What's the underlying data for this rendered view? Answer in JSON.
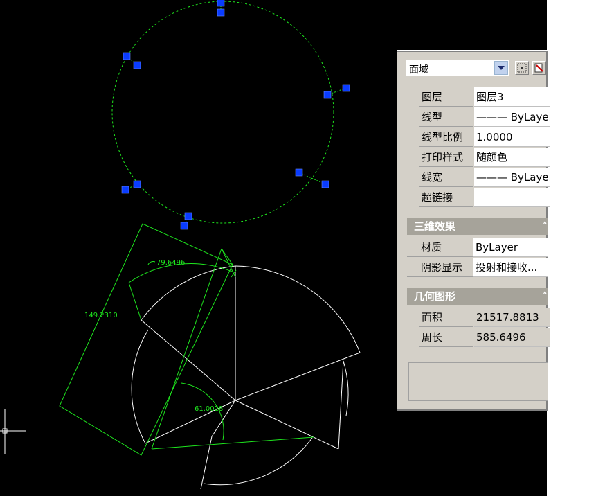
{
  "palette": {
    "object_type": "面域",
    "general": [
      {
        "key": "图层",
        "value": "图层3"
      },
      {
        "key": "线型",
        "value": "——— ByLayer"
      },
      {
        "key": "线型比例",
        "value": "1.0000"
      },
      {
        "key": "打印样式",
        "value": "随颜色"
      },
      {
        "key": "线宽",
        "value": "——— ByLayer"
      },
      {
        "key": "超链接",
        "value": ""
      }
    ],
    "sections": {
      "three_d": {
        "title": "三维效果",
        "rows": [
          {
            "key": "材质",
            "value": "ByLayer"
          },
          {
            "key": "阴影显示",
            "value": "投射和接收..."
          }
        ]
      },
      "geometry": {
        "title": "几何图形",
        "rows": [
          {
            "key": "面积",
            "value": "21517.8813"
          },
          {
            "key": "周长",
            "value": "585.6496"
          }
        ]
      }
    }
  },
  "drawing": {
    "dimensions": {
      "length_1": "149.2310",
      "arc_angle": "79.6496",
      "angle_2": "61.0028"
    },
    "colors": {
      "background": "#000000",
      "selection_dash": "#1ee61e",
      "grip": "#0a3cff",
      "geometry": "#ffffff",
      "dimension": "#1ee61e"
    }
  }
}
